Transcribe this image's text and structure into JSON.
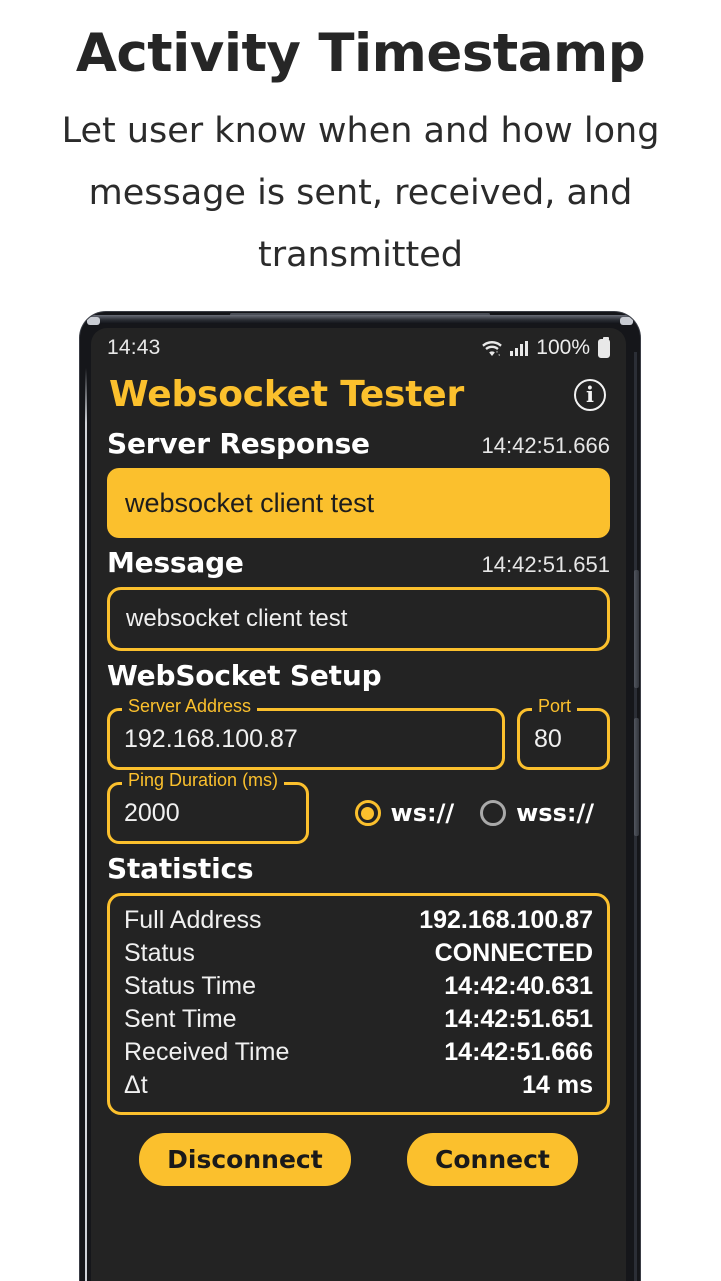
{
  "promo": {
    "title": "Activity Timestamp",
    "subtitle": "Let user know when and how long message is sent, received, and transmitted"
  },
  "colors": {
    "accent": "#FBC02D",
    "screen_bg": "#232323",
    "frame": "#15161a",
    "text_primary": "#FFFFFF"
  },
  "statusbar": {
    "time": "14:43",
    "battery_percent": "100%",
    "wifi_icon": "wifi-icon",
    "signal_icon": "cellular-signal-icon",
    "battery_icon": "battery-full-icon"
  },
  "appbar": {
    "title": "Websocket Tester",
    "info_icon": "info-icon"
  },
  "server_response": {
    "label": "Server Response",
    "timestamp": "14:42:51.666",
    "value": "websocket client test"
  },
  "message": {
    "label": "Message",
    "timestamp": "14:42:51.651",
    "value": "websocket client test",
    "placeholder": "Message"
  },
  "websocket_setup": {
    "label": "WebSocket Setup",
    "server_address": {
      "label": "Server Address",
      "value": "192.168.100.87"
    },
    "port": {
      "label": "Port",
      "value": "80"
    },
    "ping_duration": {
      "label": "Ping Duration (ms)",
      "value": "2000"
    },
    "scheme": {
      "options": [
        {
          "label": "ws://",
          "selected": true
        },
        {
          "label": "wss://",
          "selected": false
        }
      ],
      "ws_label": "ws://",
      "wss_label": "wss://"
    }
  },
  "statistics": {
    "label": "Statistics",
    "rows": [
      {
        "key": "Full Address",
        "value": "192.168.100.87"
      },
      {
        "key": "Status",
        "value": "CONNECTED"
      },
      {
        "key": "Status Time",
        "value": "14:42:40.631"
      },
      {
        "key": "Sent Time",
        "value": "14:42:51.651"
      },
      {
        "key": "Received Time",
        "value": "14:42:51.666"
      },
      {
        "key": "Δt",
        "value": "14 ms"
      }
    ]
  },
  "actions": {
    "disconnect_label": "Disconnect",
    "connect_label": "Connect"
  }
}
